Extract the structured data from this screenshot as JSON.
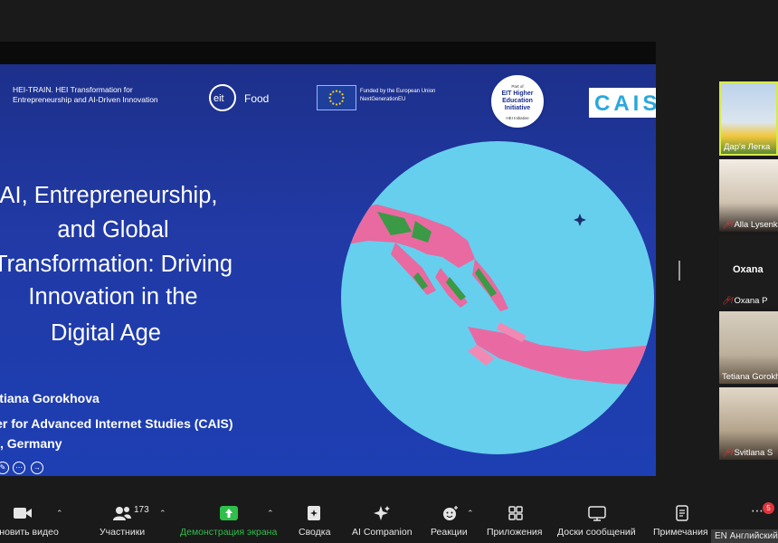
{
  "slide": {
    "header": {
      "hei_line1": "HEI-TRAIN. HEI Transformation for",
      "hei_line2": "Entrepreneurship and AI-Driven Innovation",
      "eit_logo_text": "eit",
      "eit_food": "Food",
      "eu_line1": "Funded by the European Union",
      "eu_line2": "NextGenerationEU",
      "badge_top": "Part of",
      "badge_main": "EIT Higher Education Initiative",
      "badge_bottom": "HEI Initiative",
      "cais": "CAIS"
    },
    "title_lines": [
      "AI, Entrepreneurship,",
      "and Global",
      "Transformation: Driving",
      "Innovation in the",
      "Digital Age"
    ],
    "presenter": "Tetiana Gorokhova",
    "affiliation_line1": "Center for Advanced Internet Studies (CAIS)",
    "affiliation_line2": "Bochum, Germany"
  },
  "participants": [
    {
      "name": "Дар'я Легка"
    },
    {
      "name": "Alla Lysenko",
      "muted": true
    },
    {
      "name": "Oxana P",
      "label": "Oxana",
      "muted": true
    },
    {
      "name": "Tetiana Gorokhova"
    },
    {
      "name": "Svitlana S",
      "muted": true
    }
  ],
  "toolbar": {
    "video": "Возобновить видео",
    "participants": "Участники",
    "participants_count": "173",
    "share": "Демонстрация экрана",
    "summary": "Сводка",
    "ai": "AI Companion",
    "reactions": "Реакции",
    "apps": "Приложения",
    "whiteboards": "Доски сообщений",
    "notes": "Примечания",
    "more_badge": "5",
    "language": "EN Английский"
  },
  "colors": {
    "slide_blue": "#213aa6",
    "circle_blue": "#66cfee",
    "share_green": "#2fbf4a",
    "alert_red": "#e0353b"
  }
}
